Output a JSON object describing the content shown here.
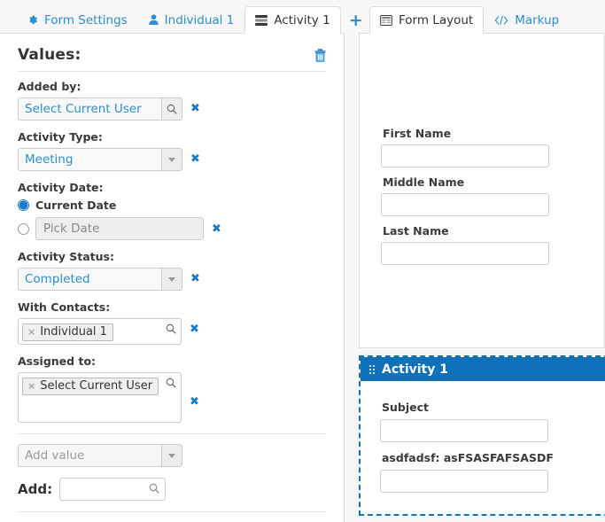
{
  "left": {
    "tabs": [
      {
        "label": "Form Settings",
        "icon": "gear-icon",
        "active": false
      },
      {
        "label": "Individual 1",
        "icon": "person-icon",
        "active": false
      },
      {
        "label": "Activity 1",
        "icon": "list-rows-icon",
        "active": true
      }
    ],
    "add_tab_label": "+",
    "values_title": "Values:",
    "delete_icon": "trash-icon",
    "fields": {
      "added_by": {
        "label": "Added by:",
        "value": "Select Current User",
        "addon_icon": "search-icon",
        "remove_label": "✖"
      },
      "activity_type": {
        "label": "Activity Type:",
        "value": "Meeting",
        "addon_icon": "chevron-down-icon",
        "remove_label": "✖"
      },
      "activity_date": {
        "label": "Activity Date:",
        "current_date_label": "Current Date",
        "current_date_selected": true,
        "pick_date_placeholder": "Pick Date",
        "pick_date_value": "",
        "remove_label": "✖"
      },
      "activity_status": {
        "label": "Activity Status:",
        "value": "Completed",
        "addon_icon": "chevron-down-icon",
        "remove_label": "✖"
      },
      "with_contacts": {
        "label": "With Contacts:",
        "tokens": [
          "Individual 1"
        ],
        "token_remove_label": "×",
        "addon_icon": "search-icon",
        "remove_label": "✖"
      },
      "assigned_to": {
        "label": "Assigned to:",
        "tokens": [
          "Select Current User"
        ],
        "token_remove_label": "×",
        "addon_icon": "search-icon",
        "remove_label": "✖"
      }
    },
    "add_value": {
      "placeholder": "Add value",
      "addon_icon": "chevron-down-icon"
    },
    "add_row": {
      "label": "Add:",
      "value": "",
      "placeholder": "",
      "icon": "search-icon"
    }
  },
  "right": {
    "tabs": [
      {
        "label": "Form Layout",
        "icon": "layout-icon",
        "active": true
      },
      {
        "label": "Markup",
        "icon": "code-icon",
        "active": false
      }
    ],
    "form_layout": {
      "fields": [
        {
          "label": "First Name",
          "value": ""
        },
        {
          "label": "Middle Name",
          "value": ""
        },
        {
          "label": "Last Name",
          "value": ""
        }
      ]
    },
    "activity_block": {
      "title": "Activity 1",
      "handle_icon": "drag-handle-icon",
      "fields": [
        {
          "label": "Subject",
          "value": ""
        },
        {
          "label": "asdfadsf: asFSASFAFSASDF",
          "value": ""
        }
      ]
    }
  },
  "colors": {
    "accent": "#2b8fd0",
    "header_blue": "#1070b8",
    "dashed_border": "#1273b8",
    "text": "#333333",
    "muted": "#9b9b9b"
  }
}
